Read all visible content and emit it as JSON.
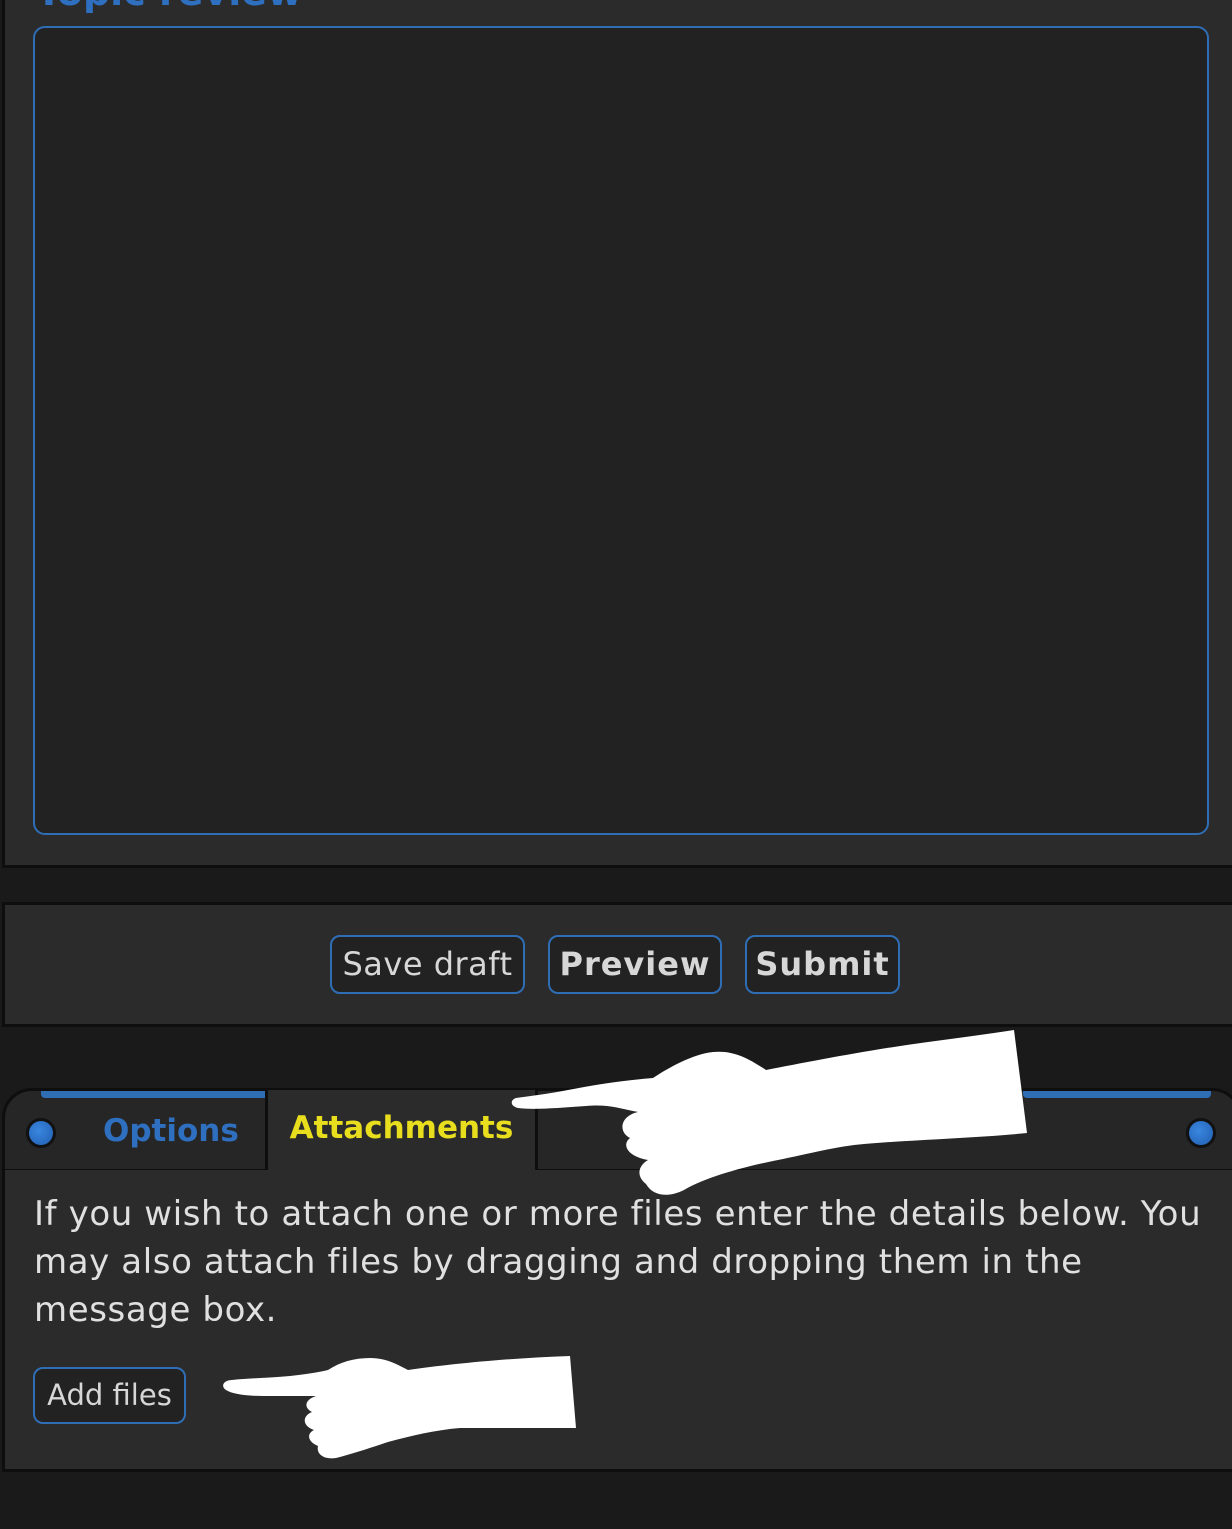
{
  "topic_review": {
    "title": "Topic review"
  },
  "form_buttons": {
    "save_draft": "Save draft",
    "preview": "Preview",
    "submit": "Submit"
  },
  "tabs": [
    {
      "label": "Options",
      "active": false
    },
    {
      "label": "Attachments",
      "active": true
    }
  ],
  "attachments": {
    "help_text": "If you wish to attach one or more files enter the details below. You may also attach files by dragging and dropping them in the message box.",
    "add_files_label": "Add files"
  },
  "overlays": {
    "icon": "pointing-hand-icon",
    "color": "#ffffff"
  },
  "colors": {
    "accent_blue": "#2f6db5",
    "active_tab_text": "#e9de1e",
    "panel_bg": "#2b2b2b",
    "page_bg": "#1a1a1a"
  }
}
